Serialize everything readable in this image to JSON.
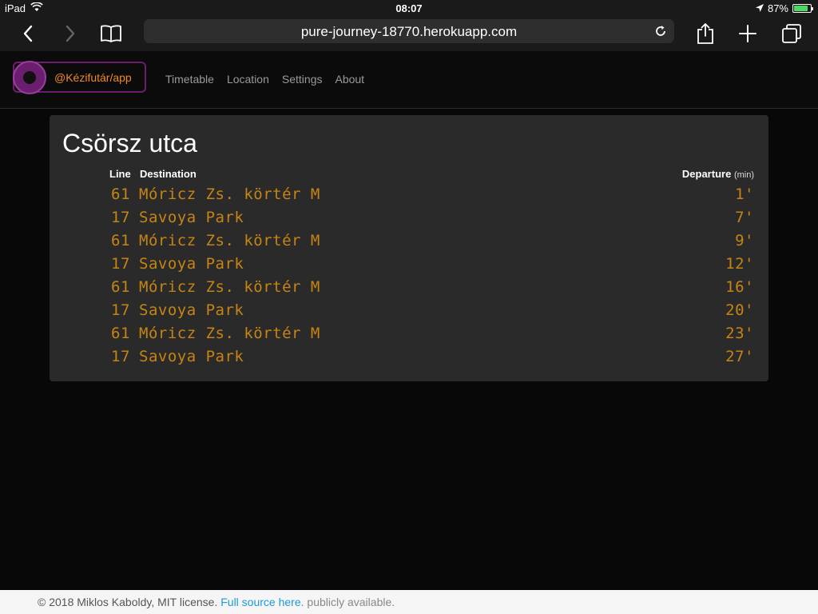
{
  "status_bar": {
    "device": "iPad",
    "time": "08:07",
    "battery": "87%",
    "battery_level": 0.87
  },
  "browser": {
    "url": "pure-journey-18770.herokuapp.com",
    "icons": [
      "back-icon",
      "forward-icon",
      "bookmarks-icon",
      "reload-icon",
      "share-icon",
      "new-tab-icon",
      "tabs-icon"
    ]
  },
  "navbar": {
    "brand": "@Kézifutár/app",
    "links": [
      "Timetable",
      "Location",
      "Settings",
      "About"
    ]
  },
  "timetable": {
    "stop_name": "Csörsz utca",
    "headers": {
      "line": "Line",
      "destination": "Destination",
      "departure": "Departure",
      "departure_unit": "(min)"
    },
    "rows": [
      {
        "line": "61",
        "destination": "Móricz Zs. körtér M",
        "departure": "1'"
      },
      {
        "line": "17",
        "destination": "Savoya Park",
        "departure": "7'"
      },
      {
        "line": "61",
        "destination": "Móricz Zs. körtér M",
        "departure": "9'"
      },
      {
        "line": "17",
        "destination": "Savoya Park",
        "departure": "12'"
      },
      {
        "line": "61",
        "destination": "Móricz Zs. körtér M",
        "departure": "16'"
      },
      {
        "line": "17",
        "destination": "Savoya Park",
        "departure": "20'"
      },
      {
        "line": "61",
        "destination": "Móricz Zs. körtér M",
        "departure": "23'"
      },
      {
        "line": "17",
        "destination": "Savoya Park",
        "departure": "27'"
      }
    ]
  },
  "footer": {
    "copyright": "© 2018 Miklos Kaboldy, MIT license.",
    "source_link": "Full source here.",
    "suffix": "publicly available."
  },
  "colors": {
    "accent_orange": "#f08a24",
    "departure_amber": "#c68414",
    "brand_purple": "#6b1e6e",
    "link_blue": "#1b9ad6"
  }
}
